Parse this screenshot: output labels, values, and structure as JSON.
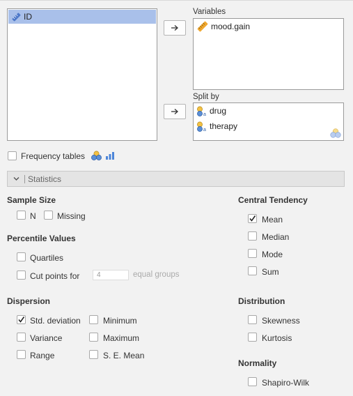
{
  "source_list": {
    "items": [
      {
        "label": "ID",
        "icon": "ruler-nominal-icon"
      }
    ]
  },
  "variables": {
    "label": "Variables",
    "items": [
      {
        "label": "mood.gain",
        "icon": "ruler-continuous-icon"
      }
    ]
  },
  "split_by": {
    "label": "Split by",
    "items": [
      {
        "label": "drug",
        "icon": "nominal-factor-icon"
      },
      {
        "label": "therapy",
        "icon": "nominal-factor-icon"
      }
    ]
  },
  "frequency_tables": {
    "label": "Frequency tables",
    "checked": false
  },
  "statistics_section": {
    "title": "Statistics",
    "expanded": true
  },
  "sample_size": {
    "heading": "Sample Size",
    "n": "N",
    "missing": "Missing"
  },
  "percentile_values": {
    "heading": "Percentile Values",
    "quartiles": "Quartiles",
    "cut_points_prefix": "Cut points for",
    "cut_points_value": "4",
    "cut_points_suffix": "equal groups"
  },
  "dispersion": {
    "heading": "Dispersion",
    "std_dev": "Std. deviation",
    "minimum": "Minimum",
    "variance": "Variance",
    "maximum": "Maximum",
    "range": "Range",
    "se_mean": "S. E. Mean"
  },
  "central_tendency": {
    "heading": "Central Tendency",
    "mean": "Mean",
    "median": "Median",
    "mode": "Mode",
    "sum": "Sum"
  },
  "distribution": {
    "heading": "Distribution",
    "skewness": "Skewness",
    "kurtosis": "Kurtosis"
  },
  "normality": {
    "heading": "Normality",
    "shapiro_wilk": "Shapiro-Wilk"
  },
  "checked_items": [
    "Std. deviation",
    "Mean"
  ],
  "colors": {
    "selection": "#a9c0ea",
    "ruler": "#f0a830",
    "factor_yellow": "#f3c144",
    "factor_blue": "#5b8fd6"
  }
}
